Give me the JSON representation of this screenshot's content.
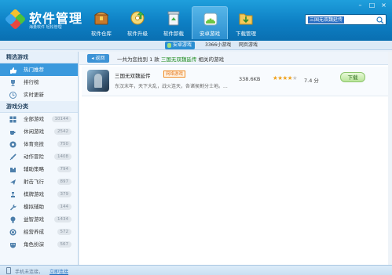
{
  "app": {
    "title": "软件管理",
    "subtitle": "海量软件 轻松管理"
  },
  "window_buttons": [
    "–",
    "□",
    "×"
  ],
  "nav": [
    {
      "label": "软件仓库",
      "icon": "treasure-box-icon"
    },
    {
      "label": "软件升级",
      "icon": "disc-upgrade-icon"
    },
    {
      "label": "软件卸载",
      "icon": "recycle-bin-icon"
    },
    {
      "label": "安卓游戏",
      "icon": "android-game-icon",
      "active": true
    },
    {
      "label": "下载管理",
      "icon": "download-folder-icon"
    }
  ],
  "search": {
    "value": "三国无双魏延传"
  },
  "subbar": {
    "active_tab": "安卓游戏",
    "count_text": "3366小游戏",
    "web_tab": "网页游戏"
  },
  "sidebar": {
    "featured_title": "精选游戏",
    "featured": [
      {
        "label": "热门推荐",
        "icon": "thumb-up-icon",
        "active": true
      },
      {
        "label": "排行榜",
        "icon": "trophy-icon"
      },
      {
        "label": "实时更新",
        "icon": "clock-icon"
      }
    ],
    "category_title": "游戏分类",
    "categories": [
      {
        "label": "全部游戏",
        "count": "10144",
        "icon": "grid-icon"
      },
      {
        "label": "休闲游戏",
        "count": "2542",
        "icon": "coffee-icon"
      },
      {
        "label": "体育竞技",
        "count": "750",
        "icon": "soccer-icon"
      },
      {
        "label": "动作冒险",
        "count": "1408",
        "icon": "sword-icon"
      },
      {
        "label": "辅助策略",
        "count": "794",
        "icon": "puzzle-icon"
      },
      {
        "label": "射击飞行",
        "count": "897",
        "icon": "plane-icon"
      },
      {
        "label": "棋牌游戏",
        "count": "379",
        "icon": "chess-icon"
      },
      {
        "label": "模拟辅助",
        "count": "144",
        "icon": "wrench-icon"
      },
      {
        "label": "益智游戏",
        "count": "1434",
        "icon": "bulb-icon"
      },
      {
        "label": "经营养成",
        "count": "572",
        "icon": "coin-icon"
      },
      {
        "label": "角色扮演",
        "count": "567",
        "icon": "mask-icon"
      }
    ]
  },
  "result": {
    "back_label": "返回",
    "prefix": "一共为您找到 1 款",
    "keyword": "三国无双魏延传",
    "suffix": "相关的游戏"
  },
  "game": {
    "name": "三国无双魏延传",
    "tag": "网络游戏",
    "description": "东汉末年，天下大乱，战火连天，各诸侯割分士地。...",
    "size": "338.6KB",
    "stars_filled": 4,
    "stars_total": 5,
    "rating": "7.4 分",
    "download_label": "下载"
  },
  "status": {
    "text": "手机未连接，",
    "link": "立即连接"
  },
  "colors": {
    "header": "#0d7fc4",
    "active_blue": "#3a99dd",
    "keyword_green": "#1a8a1a",
    "tag_orange": "#e5761a"
  }
}
